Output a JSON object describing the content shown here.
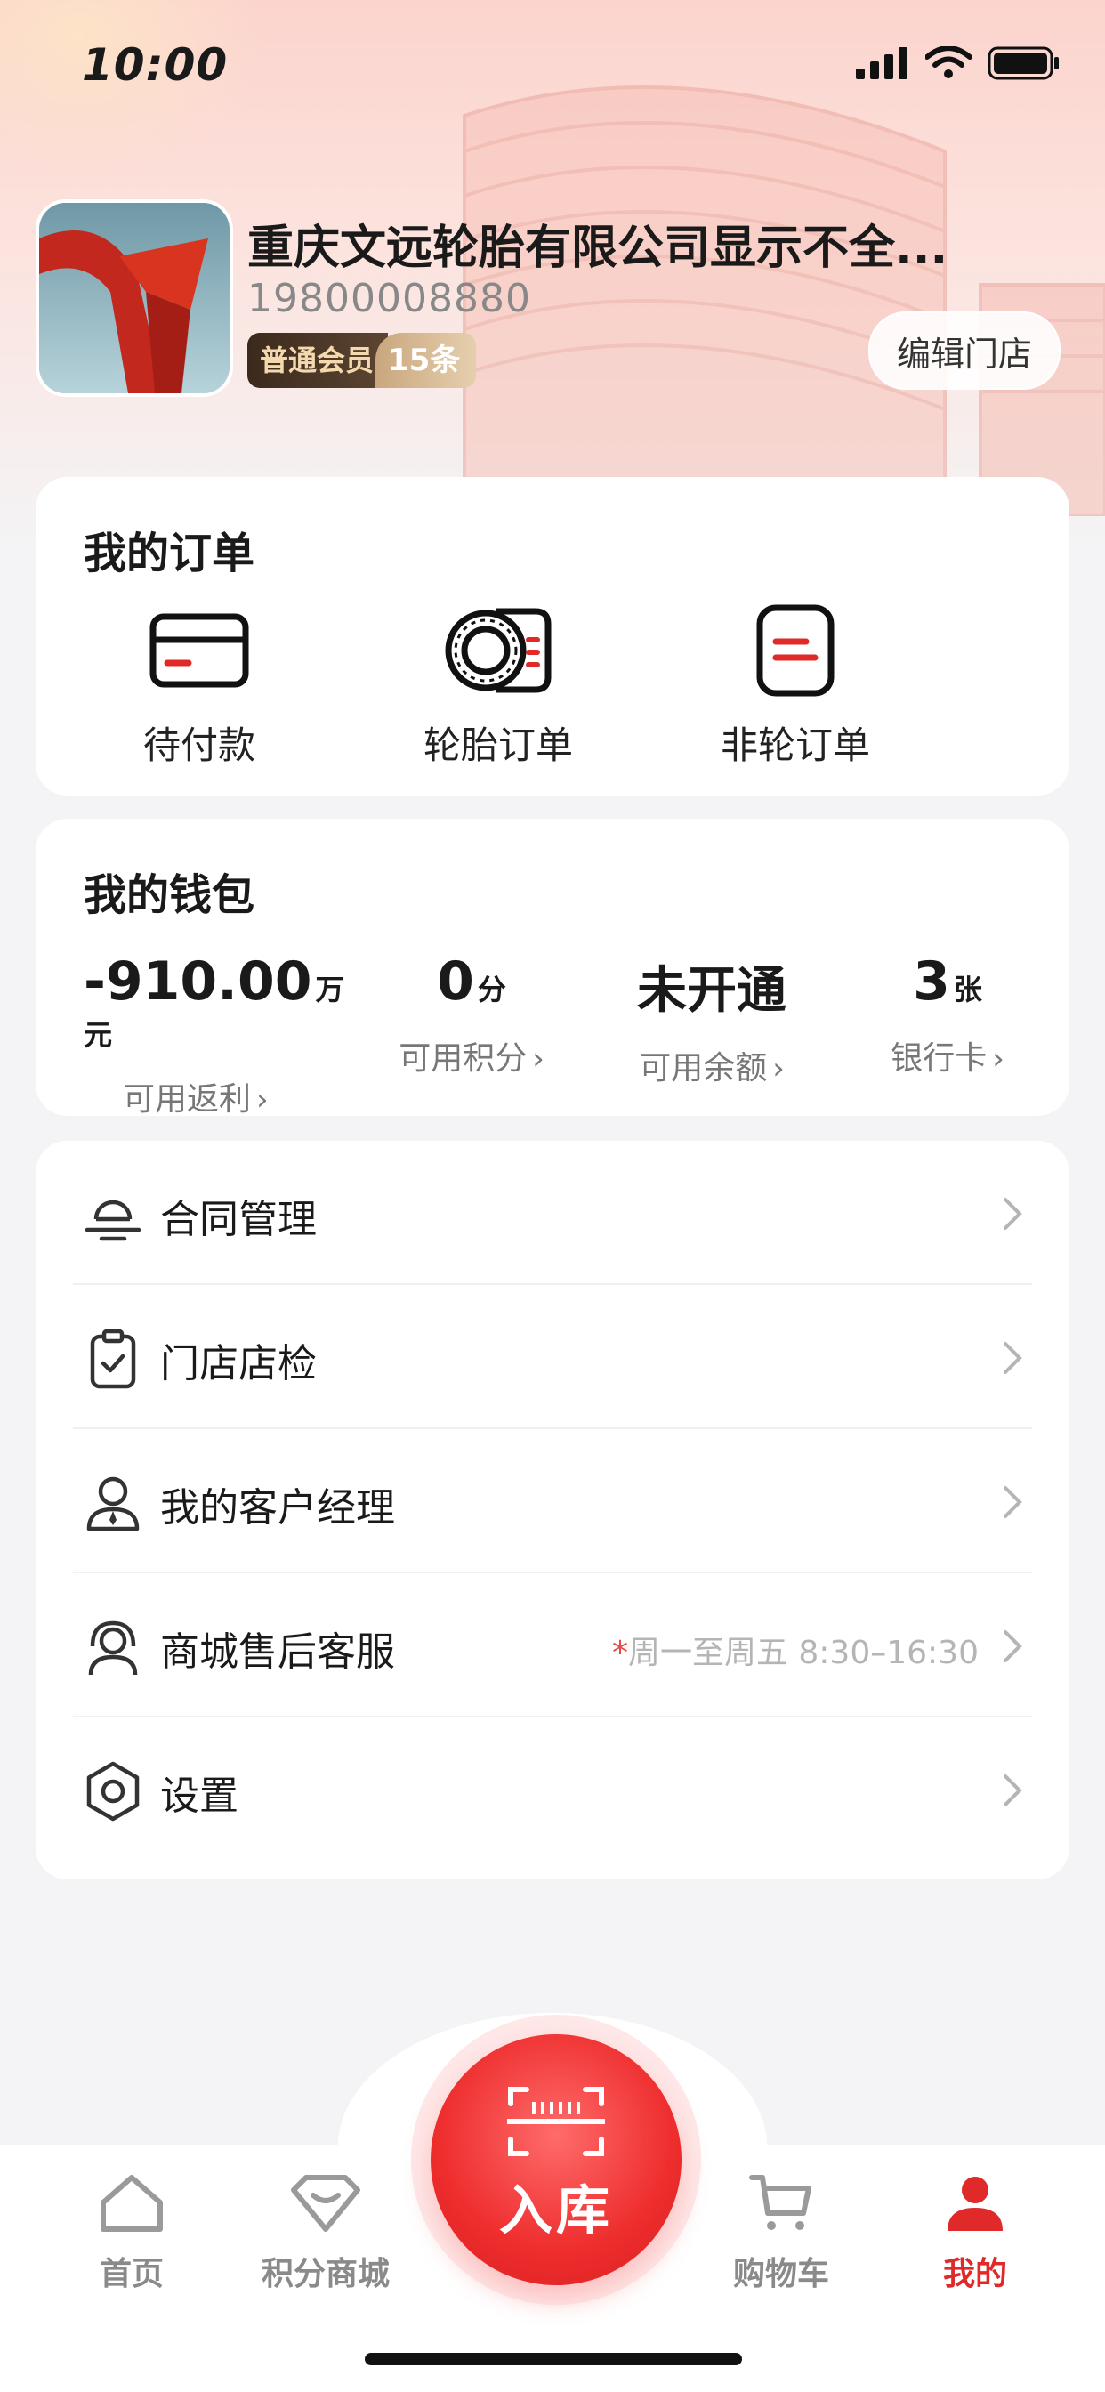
{
  "status_bar": {
    "time": "10:00"
  },
  "profile": {
    "shop_name": "重庆文远轮胎有限公司显示不全...",
    "phone": "19800008880",
    "member_level": "普通会员",
    "member_count": "15条",
    "edit_button": "编辑门店"
  },
  "orders": {
    "title": "我的订单",
    "items": [
      {
        "label": "待付款",
        "icon": "card-icon"
      },
      {
        "label": "轮胎订单",
        "icon": "tire-icon"
      },
      {
        "label": "非轮订单",
        "icon": "parts-icon"
      }
    ]
  },
  "wallet": {
    "title": "我的钱包",
    "items": [
      {
        "value": "-910.00",
        "unit": "万元",
        "label": "可用返利"
      },
      {
        "value": "0",
        "unit": "分",
        "label": "可用积分"
      },
      {
        "value": "未开通",
        "unit": "",
        "label": "可用余额"
      },
      {
        "value": "3",
        "unit": "张",
        "label": "银行卡"
      }
    ]
  },
  "menu": [
    {
      "label": "合同管理",
      "icon": "contract-icon"
    },
    {
      "label": "门店店检",
      "icon": "clipboard-check-icon"
    },
    {
      "label": "我的客户经理",
      "icon": "manager-icon"
    },
    {
      "label": "商城售后客服",
      "icon": "customer-service-icon",
      "note_star": "*",
      "note": "周一至周五 8:30–16:30"
    },
    {
      "label": "设置",
      "icon": "settings-icon"
    }
  ],
  "tabbar": {
    "items": [
      {
        "label": "首页",
        "icon": "home-icon"
      },
      {
        "label": "积分商城",
        "icon": "points-mall-icon"
      },
      {
        "label": "购物车",
        "icon": "cart-icon"
      },
      {
        "label": "我的",
        "icon": "user-icon",
        "active": true
      }
    ],
    "center_label": "入库"
  },
  "colors": {
    "accent": "#e02a2a",
    "badge_dark": "#3b2a1c",
    "badge_gold": "#c9a77e"
  }
}
